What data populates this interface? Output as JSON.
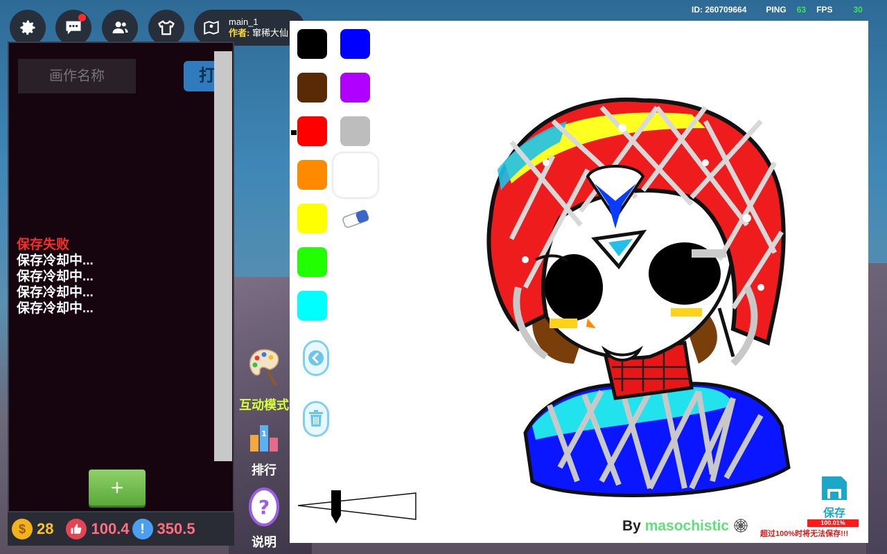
{
  "status": {
    "id_label": "ID: 260709664",
    "ping_label": "PING",
    "ping_value": "63",
    "fps_label": "FPS",
    "fps_value": "30"
  },
  "topbar": {
    "map_name": "main_1",
    "author_label": "作者:",
    "author_name": "窜稀大仙",
    "chat_has_notification": true
  },
  "left_panel": {
    "name_placeholder": "画作名称",
    "open_label": "打",
    "add_label": "+",
    "log": {
      "error": "保存失败",
      "messages": [
        "保存冷却中...",
        "保存冷却中...",
        "保存冷却中...",
        "保存冷却中..."
      ]
    }
  },
  "stats": {
    "coins": "28",
    "likes": "100.4",
    "alerts": "350.5",
    "coin_symbol": "$",
    "alert_symbol": "!"
  },
  "side_buttons": {
    "interactive_mode": "互动模式",
    "ranking": "排行",
    "help": "说明"
  },
  "palette": {
    "colors": [
      "#000000",
      "#0000ff",
      "#5a2a06",
      "#b000ff",
      "#ff0000",
      "#bdbdbd",
      "#ff8a00",
      "#ffffff",
      "#ffff00",
      "#22ff00",
      "#00ffff"
    ]
  },
  "canvas": {
    "byline_prefix": "By ",
    "byline_user": "masochistic",
    "save_label": "保存",
    "usage_percent": "100.01%",
    "warning": "超过100%时将无法保存!!!"
  },
  "colors": {
    "accent_green": "#3fe25a",
    "error_red": "#ff2b2b",
    "save_blue": "#1aa7c8"
  },
  "icons": [
    "gear-icon",
    "chat-icon",
    "friends-icon",
    "shirt-icon",
    "map-pin-icon",
    "coin-icon",
    "thumbs-up-icon",
    "exclamation-icon",
    "palette-icon",
    "ranking-icon",
    "help-icon",
    "eraser-icon",
    "back-arrow-icon",
    "trash-icon",
    "save-disk-icon",
    "spider-web-icon"
  ]
}
